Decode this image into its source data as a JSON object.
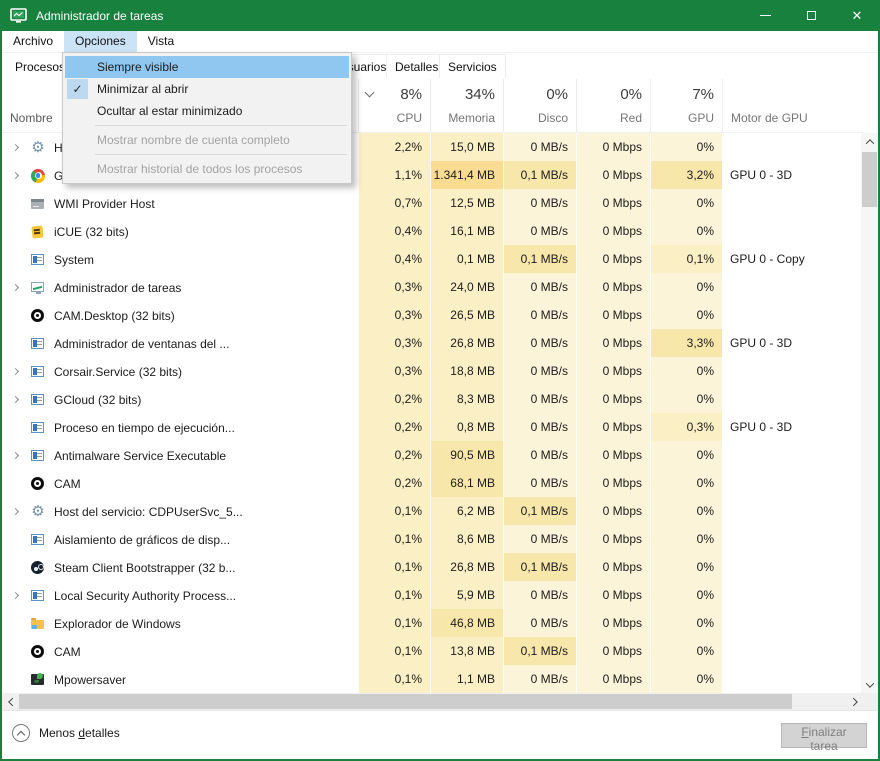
{
  "window": {
    "title": "Administrador de tareas",
    "accent_green": "#17813d"
  },
  "menubar": {
    "items": [
      "Archivo",
      "Opciones",
      "Vista"
    ],
    "open_item": "Opciones"
  },
  "options_menu": {
    "items": [
      {
        "label": "Siempre visible",
        "highlighted": true,
        "enabled": true,
        "checked": false
      },
      {
        "label": "Minimizar al abrir",
        "highlighted": false,
        "enabled": true,
        "checked": true
      },
      {
        "label": "Ocultar al estar minimizado",
        "highlighted": false,
        "enabled": true,
        "checked": false
      },
      {
        "separator": true
      },
      {
        "label": "Mostrar nombre de cuenta completo",
        "highlighted": false,
        "enabled": false,
        "checked": false
      },
      {
        "separator": true
      },
      {
        "label": "Mostrar historial de todos los procesos",
        "highlighted": false,
        "enabled": false,
        "checked": false
      }
    ]
  },
  "tabs": [
    {
      "label": "Procesos",
      "active": true
    },
    {
      "label": "Usuarios",
      "active": false
    },
    {
      "label": "Detalles",
      "active": false
    },
    {
      "label": "Servicios",
      "active": false
    }
  ],
  "columns": {
    "name_header": "Nombre",
    "usage": [
      {
        "total": "8%",
        "label": "CPU"
      },
      {
        "total": "34%",
        "label": "Memoria"
      },
      {
        "total": "0%",
        "label": "Disco"
      },
      {
        "total": "0%",
        "label": "Red"
      },
      {
        "total": "7%",
        "label": "GPU"
      }
    ],
    "engine_header": "Motor de GPU"
  },
  "process_table": {
    "rows": [
      {
        "name": "Host del servicio",
        "icon": "gear",
        "expand": true,
        "cpu": "2,2%",
        "mem": "15,0 MB",
        "disk": "0 MB/s",
        "net": "0 Mbps",
        "gpu": "0%",
        "engine": ""
      },
      {
        "name": "Google Chrome",
        "icon": "chrome",
        "expand": true,
        "cpu": "1,1%",
        "mem": "1.341,4 MB",
        "disk": "0,1 MB/s",
        "net": "0 Mbps",
        "gpu": "3,2%",
        "engine": "GPU 0 - 3D"
      },
      {
        "name": "WMI Provider Host",
        "icon": "device",
        "expand": false,
        "cpu": "0,7%",
        "mem": "12,5 MB",
        "disk": "0 MB/s",
        "net": "0 Mbps",
        "gpu": "0%",
        "engine": ""
      },
      {
        "name": "iCUE (32 bits)",
        "icon": "icue",
        "expand": false,
        "cpu": "0,4%",
        "mem": "16,1 MB",
        "disk": "0 MB/s",
        "net": "0 Mbps",
        "gpu": "0%",
        "engine": ""
      },
      {
        "name": "System",
        "icon": "window",
        "expand": false,
        "cpu": "0,4%",
        "mem": "0,1 MB",
        "disk": "0,1 MB/s",
        "net": "0 Mbps",
        "gpu": "0,1%",
        "engine": "GPU 0 - Copy"
      },
      {
        "name": "Administrador de tareas",
        "icon": "taskmgr",
        "expand": true,
        "cpu": "0,3%",
        "mem": "24,0 MB",
        "disk": "0 MB/s",
        "net": "0 Mbps",
        "gpu": "0%",
        "engine": ""
      },
      {
        "name": "CAM.Desktop (32 bits)",
        "icon": "cam",
        "expand": false,
        "cpu": "0,3%",
        "mem": "26,5 MB",
        "disk": "0 MB/s",
        "net": "0 Mbps",
        "gpu": "0%",
        "engine": ""
      },
      {
        "name": "Administrador de ventanas del ...",
        "icon": "window",
        "expand": false,
        "cpu": "0,3%",
        "mem": "26,8 MB",
        "disk": "0 MB/s",
        "net": "0 Mbps",
        "gpu": "3,3%",
        "engine": "GPU 0 - 3D"
      },
      {
        "name": "Corsair.Service (32 bits)",
        "icon": "window",
        "expand": true,
        "cpu": "0,3%",
        "mem": "18,8 MB",
        "disk": "0 MB/s",
        "net": "0 Mbps",
        "gpu": "0%",
        "engine": ""
      },
      {
        "name": "GCloud (32 bits)",
        "icon": "window",
        "expand": true,
        "cpu": "0,2%",
        "mem": "8,3 MB",
        "disk": "0 MB/s",
        "net": "0 Mbps",
        "gpu": "0%",
        "engine": ""
      },
      {
        "name": "Proceso en tiempo de ejecución...",
        "icon": "window",
        "expand": false,
        "cpu": "0,2%",
        "mem": "0,8 MB",
        "disk": "0 MB/s",
        "net": "0 Mbps",
        "gpu": "0,3%",
        "engine": "GPU 0 - 3D"
      },
      {
        "name": "Antimalware Service Executable",
        "icon": "window",
        "expand": true,
        "cpu": "0,2%",
        "mem": "90,5 MB",
        "disk": "0 MB/s",
        "net": "0 Mbps",
        "gpu": "0%",
        "engine": ""
      },
      {
        "name": "CAM",
        "icon": "cam",
        "expand": false,
        "cpu": "0,2%",
        "mem": "68,1 MB",
        "disk": "0 MB/s",
        "net": "0 Mbps",
        "gpu": "0%",
        "engine": ""
      },
      {
        "name": "Host del servicio: CDPUserSvc_5...",
        "icon": "gear",
        "expand": true,
        "cpu": "0,1%",
        "mem": "6,2 MB",
        "disk": "0,1 MB/s",
        "net": "0 Mbps",
        "gpu": "0%",
        "engine": ""
      },
      {
        "name": "Aislamiento de gráficos de disp...",
        "icon": "window",
        "expand": false,
        "cpu": "0,1%",
        "mem": "8,6 MB",
        "disk": "0 MB/s",
        "net": "0 Mbps",
        "gpu": "0%",
        "engine": ""
      },
      {
        "name": "Steam Client Bootstrapper (32 b...",
        "icon": "steam",
        "expand": false,
        "cpu": "0,1%",
        "mem": "26,8 MB",
        "disk": "0,1 MB/s",
        "net": "0 Mbps",
        "gpu": "0%",
        "engine": ""
      },
      {
        "name": "Local Security Authority Process...",
        "icon": "window",
        "expand": true,
        "cpu": "0,1%",
        "mem": "5,9 MB",
        "disk": "0 MB/s",
        "net": "0 Mbps",
        "gpu": "0%",
        "engine": ""
      },
      {
        "name": "Explorador de Windows",
        "icon": "folder",
        "expand": false,
        "cpu": "0,1%",
        "mem": "46,8 MB",
        "disk": "0 MB/s",
        "net": "0 Mbps",
        "gpu": "0%",
        "engine": ""
      },
      {
        "name": "CAM",
        "icon": "cam",
        "expand": false,
        "cpu": "0,1%",
        "mem": "13,8 MB",
        "disk": "0,1 MB/s",
        "net": "0 Mbps",
        "gpu": "0%",
        "engine": ""
      },
      {
        "name": "Mpowersaver",
        "icon": "mpower",
        "expand": false,
        "cpu": "0,1%",
        "mem": "1,1 MB",
        "disk": "0 MB/s",
        "net": "0 Mbps",
        "gpu": "0%",
        "engine": ""
      }
    ]
  },
  "statusbar": {
    "toggle": {
      "pre": "Menos ",
      "accel": "d",
      "post": "etalles"
    },
    "end_task": {
      "accel": "F",
      "post": "inalizar tarea",
      "enabled": false
    }
  },
  "heat_colors": {
    "none": "#fcf4d8",
    "low": "#fbefc6",
    "mid": "#f8e7ab",
    "high": "#f9dc92"
  }
}
